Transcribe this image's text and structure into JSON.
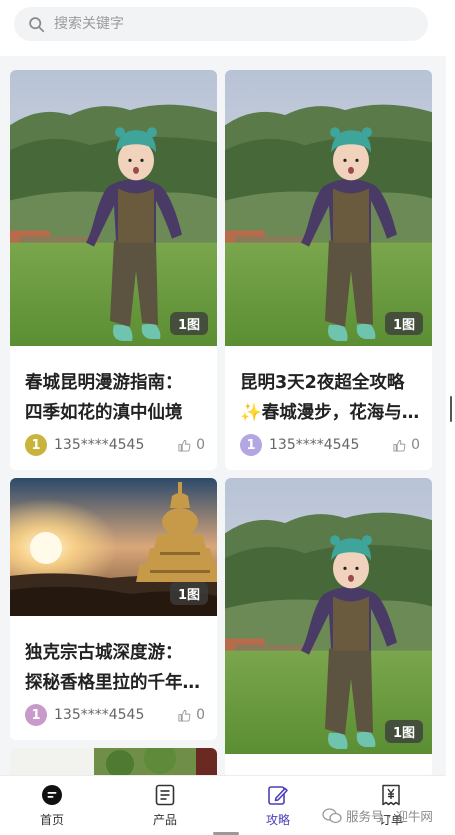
{
  "search": {
    "placeholder": "搜索关键字"
  },
  "cards": [
    {
      "title_line1": "春城昆明漫游指南：",
      "title_line2": "四季如花的滇中仙境",
      "badge": "1图",
      "avatar_text": "1",
      "avatar_color": "#c8b43a",
      "user": "135****4545",
      "likes": "0"
    },
    {
      "title_line1": "昆明3天2夜超全攻略",
      "title_line2": "✨春城漫步，花海与美食的浪漫之旅",
      "badge": "1图",
      "avatar_text": "1",
      "avatar_color": "#b3a6e3",
      "user": "135****4545",
      "likes": "0"
    },
    {
      "title_line1": "独克宗古城深度游：",
      "title_line2": "探秘香格里拉的千年古城之美",
      "badge": "1图",
      "avatar_text": "1",
      "avatar_color": "#c79ac9",
      "user": "135****4545",
      "likes": "0"
    },
    {
      "badge": "1图"
    }
  ],
  "tabs": [
    {
      "label": "首页",
      "icon": "chat-bubble-icon"
    },
    {
      "label": "产品",
      "icon": "list-icon"
    },
    {
      "label": "攻略",
      "icon": "pencil-icon"
    },
    {
      "label": "订单",
      "icon": "yen-receipt-icon"
    }
  ],
  "active_tab": "攻略",
  "watermark": "服务号 · 迎牛网",
  "colors": {
    "accent": "#4a3fb6",
    "badge_bg": "#3c3c3c"
  }
}
